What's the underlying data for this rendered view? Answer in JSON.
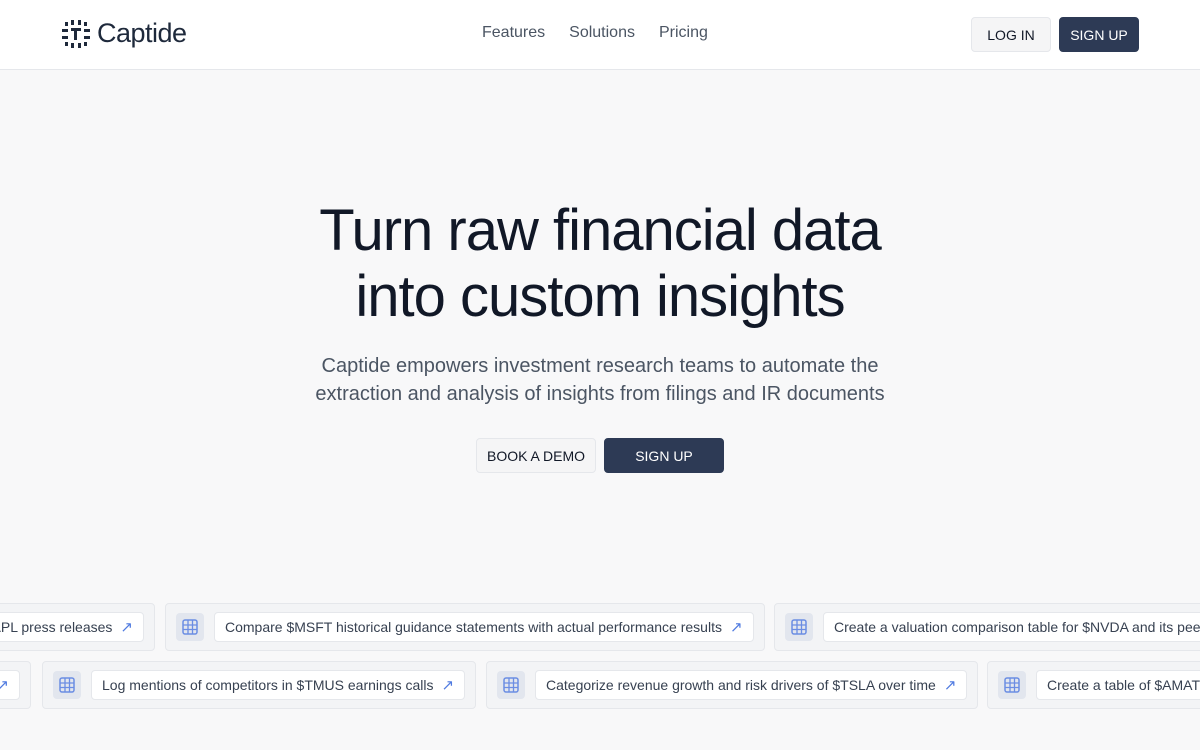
{
  "header": {
    "logo": "Captide",
    "nav": [
      "Features",
      "Solutions",
      "Pricing"
    ],
    "login": "LOG IN",
    "signup": "SIGN UP"
  },
  "hero": {
    "title_line1": "Turn raw financial data",
    "title_line2": "into custom insights",
    "subtitle_line1": "Captide empowers investment research teams to automate the",
    "subtitle_line2": "extraction and analysis of insights from filings and IR documents",
    "demo": "BOOK A DEMO",
    "signup": "SIGN UP"
  },
  "prompts_row1": [
    "APL press releases",
    "Compare $MSFT historical guidance statements with actual performance results",
    "Create a valuation comparison table for $NVDA and its peers"
  ],
  "prompts_row2": [
    "",
    "Log mentions of competitors in $TMUS earnings calls",
    "Categorize revenue growth and risk drivers of $TSLA over time",
    "Create a table of $AMAT"
  ],
  "colors": {
    "primary": "#2d3a55",
    "accent": "#4f7ae0"
  }
}
